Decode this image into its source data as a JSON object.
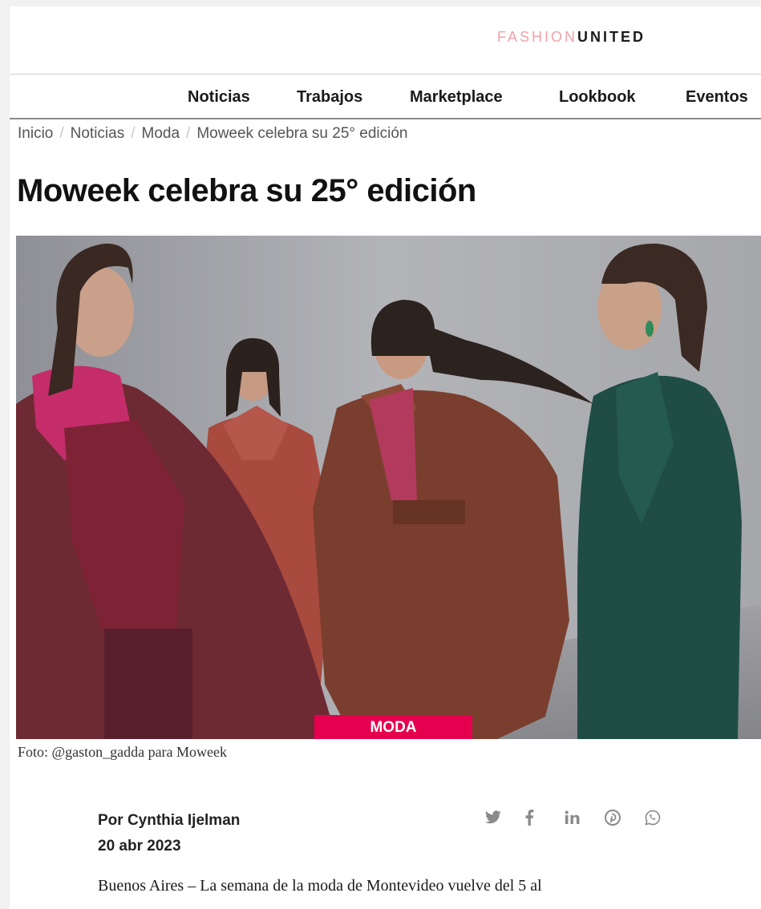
{
  "brand": {
    "part1": "FASHION",
    "part2": "UNITED"
  },
  "nav": {
    "items": [
      "Noticias",
      "Trabajos",
      "Marketplace",
      "Lookbook",
      "Eventos"
    ]
  },
  "breadcrumb": [
    "Inicio",
    "Noticias",
    "Moda",
    "Moweek celebra su 25° edición"
  ],
  "article": {
    "title": "Moweek celebra su 25° edición",
    "category_badge": "MODA",
    "photo_caption": "Foto: @gaston_gadda para Moweek",
    "author": "Por Cynthia Ijelman",
    "date": "20 abr 2023",
    "body_first_line": "Buenos Aires – La semana de la moda de Montevideo vuelve del 5 al"
  },
  "share": [
    "twitter-icon",
    "facebook-icon",
    "linkedin-icon",
    "pinterest-icon",
    "whatsapp-icon"
  ],
  "colors": {
    "accent": "#e5004f",
    "logo_light": "#f2a0a8"
  }
}
